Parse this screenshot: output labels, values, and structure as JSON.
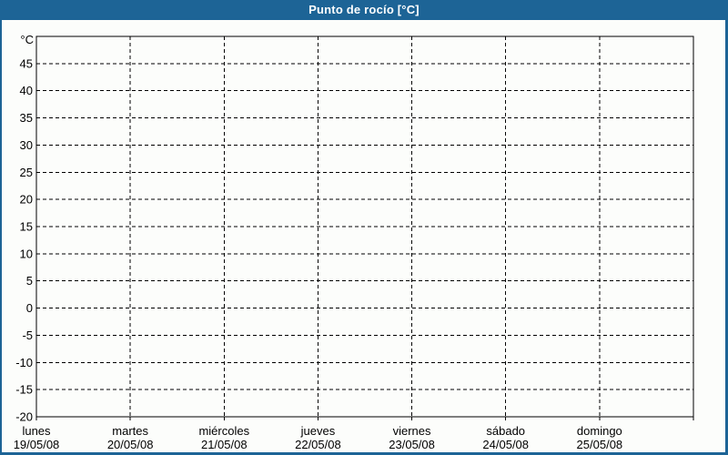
{
  "header": {
    "title": "Punto de rocío [°C]"
  },
  "colors": {
    "header_bg": "#1d6496",
    "header_text": "#ffffff",
    "frame_border": "#1d6496",
    "plot_border": "#000000",
    "grid": "#000000",
    "label_text": "#000000",
    "plot_background": "#fcfdfb"
  },
  "chart_data": {
    "type": "line",
    "title": "Punto de rocío [°C]",
    "y_unit_label": "°C",
    "ylim": [
      -20,
      50
    ],
    "y_tick_step": 5,
    "y_tick_labels": [
      45,
      40,
      35,
      30,
      25,
      20,
      15,
      10,
      5,
      0,
      -5,
      -10,
      -15,
      -20
    ],
    "grid": "dashed",
    "legend": "none",
    "x_categories": [
      {
        "weekday": "lunes",
        "date": "19/05/08"
      },
      {
        "weekday": "martes",
        "date": "20/05/08"
      },
      {
        "weekday": "miércoles",
        "date": "21/05/08"
      },
      {
        "weekday": "jueves",
        "date": "22/05/08"
      },
      {
        "weekday": "viernes",
        "date": "23/05/08"
      },
      {
        "weekday": "sábado",
        "date": "24/05/08"
      },
      {
        "weekday": "domingo",
        "date": "25/05/08"
      }
    ],
    "series": []
  }
}
